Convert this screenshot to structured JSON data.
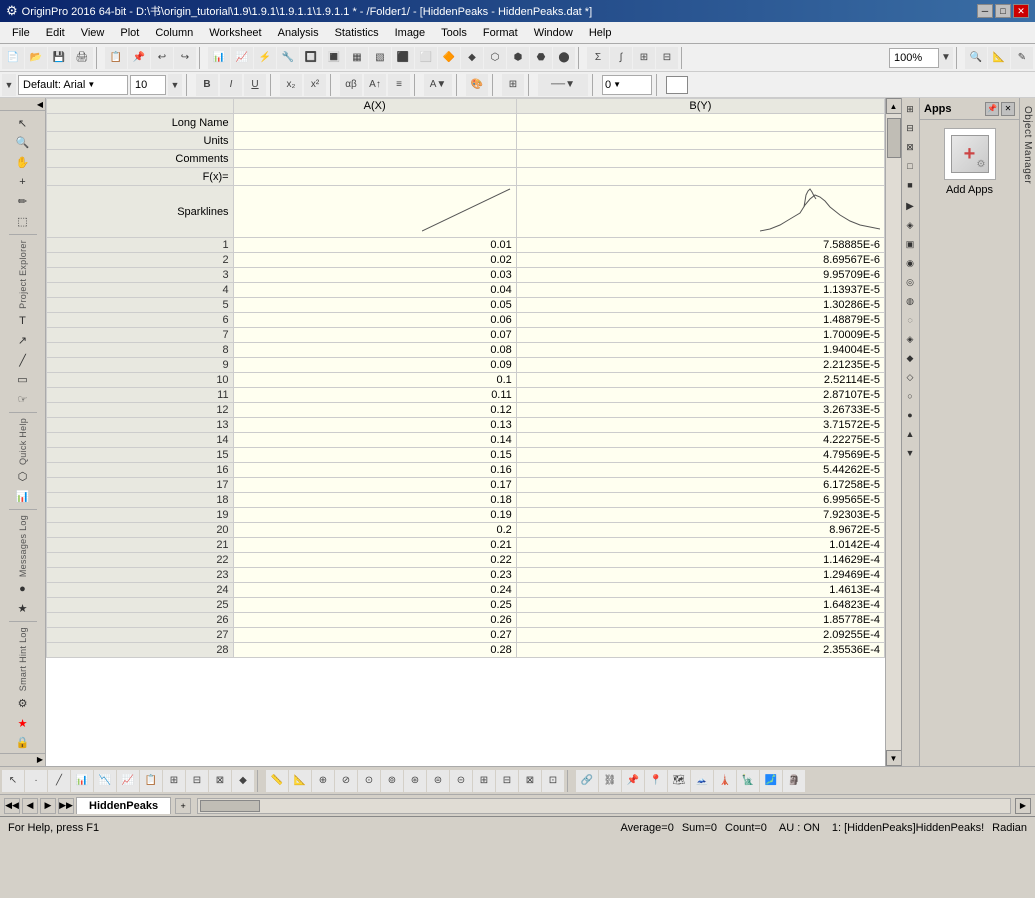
{
  "title_bar": {
    "icon": "⚙",
    "text": "OriginPro 2016 64-bit - D:\\书\\origin_tutorial\\1.9\\1.9.1\\1.9.1.1\\1.9.1.1 * - /Folder1/ - [HiddenPeaks - HiddenPeaks.dat *]",
    "minimize": "─",
    "maximize": "□",
    "close": "✕"
  },
  "menu": {
    "items": [
      "File",
      "Edit",
      "View",
      "Plot",
      "Column",
      "Worksheet",
      "Analysis",
      "Statistics",
      "Image",
      "Tools",
      "Format",
      "Window",
      "Help"
    ]
  },
  "toolbar1": {
    "zoom_value": "100%"
  },
  "format_toolbar": {
    "font_name": "Default: Arial",
    "font_size": "10",
    "bold": "B",
    "italic": "I",
    "underline": "U",
    "color_label": "0"
  },
  "worksheet": {
    "col_a_header": "A(X)",
    "col_b_header": "B(Y)",
    "row_labels": {
      "long_name": "Long Name",
      "units": "Units",
      "comments": "Comments",
      "fx": "F(x)=",
      "sparklines": "Sparklines"
    },
    "rows": [
      {
        "num": 1,
        "a": "0.01",
        "b": "7.58885E-6"
      },
      {
        "num": 2,
        "a": "0.02",
        "b": "8.69567E-6"
      },
      {
        "num": 3,
        "a": "0.03",
        "b": "9.95709E-6"
      },
      {
        "num": 4,
        "a": "0.04",
        "b": "1.13937E-5"
      },
      {
        "num": 5,
        "a": "0.05",
        "b": "1.30286E-5"
      },
      {
        "num": 6,
        "a": "0.06",
        "b": "1.48879E-5"
      },
      {
        "num": 7,
        "a": "0.07",
        "b": "1.70009E-5"
      },
      {
        "num": 8,
        "a": "0.08",
        "b": "1.94004E-5"
      },
      {
        "num": 9,
        "a": "0.09",
        "b": "2.21235E-5"
      },
      {
        "num": 10,
        "a": "0.1",
        "b": "2.52114E-5"
      },
      {
        "num": 11,
        "a": "0.11",
        "b": "2.87107E-5"
      },
      {
        "num": 12,
        "a": "0.12",
        "b": "3.26733E-5"
      },
      {
        "num": 13,
        "a": "0.13",
        "b": "3.71572E-5"
      },
      {
        "num": 14,
        "a": "0.14",
        "b": "4.22275E-5"
      },
      {
        "num": 15,
        "a": "0.15",
        "b": "4.79569E-5"
      },
      {
        "num": 16,
        "a": "0.16",
        "b": "5.44262E-5"
      },
      {
        "num": 17,
        "a": "0.17",
        "b": "6.17258E-5"
      },
      {
        "num": 18,
        "a": "0.18",
        "b": "6.99565E-5"
      },
      {
        "num": 19,
        "a": "0.19",
        "b": "7.92303E-5"
      },
      {
        "num": 20,
        "a": "0.2",
        "b": "8.9672E-5"
      },
      {
        "num": 21,
        "a": "0.21",
        "b": "1.0142E-4"
      },
      {
        "num": 22,
        "a": "0.22",
        "b": "1.14629E-4"
      },
      {
        "num": 23,
        "a": "0.23",
        "b": "1.29469E-4"
      },
      {
        "num": 24,
        "a": "0.24",
        "b": "1.4613E-4"
      },
      {
        "num": 25,
        "a": "0.25",
        "b": "1.64823E-4"
      },
      {
        "num": 26,
        "a": "0.26",
        "b": "1.85778E-4"
      },
      {
        "num": 27,
        "a": "0.27",
        "b": "2.09255E-4"
      },
      {
        "num": 28,
        "a": "0.28",
        "b": "2.35536E-4"
      }
    ]
  },
  "apps_panel": {
    "title": "Apps",
    "pin_icon": "📌",
    "close_icon": "✕",
    "add_apps_label": "Add Apps",
    "add_icon": "+"
  },
  "object_manager": {
    "label": "Object Manager"
  },
  "sheet_tabs": {
    "nav_first": "◀◀",
    "nav_prev": "◀",
    "nav_next": "▶",
    "nav_last": "▶▶",
    "active_tab": "HiddenPeaks",
    "plus": "+"
  },
  "status_bar": {
    "help_text": "For Help, press F1",
    "average": "Average=0",
    "sum": "Sum=0",
    "count": "Count=0",
    "au": "AU : ON",
    "workbook": "1: [HiddenPeaks]HiddenPeaks!",
    "mode": "Radian"
  },
  "left_sidebar_labels": {
    "project_explorer": "Project Explorer",
    "quick_help": "Quick Help",
    "messages_log": "Messages Log",
    "smart_hint_log": "Smart Hint Log"
  },
  "right_icons": [
    "▲",
    "▼",
    "◀",
    "▶",
    "■",
    "□",
    "▣",
    "▤",
    "▥",
    "▦",
    "▧",
    "▨",
    "▩",
    "◆",
    "◇",
    "○",
    "●",
    "▲"
  ]
}
